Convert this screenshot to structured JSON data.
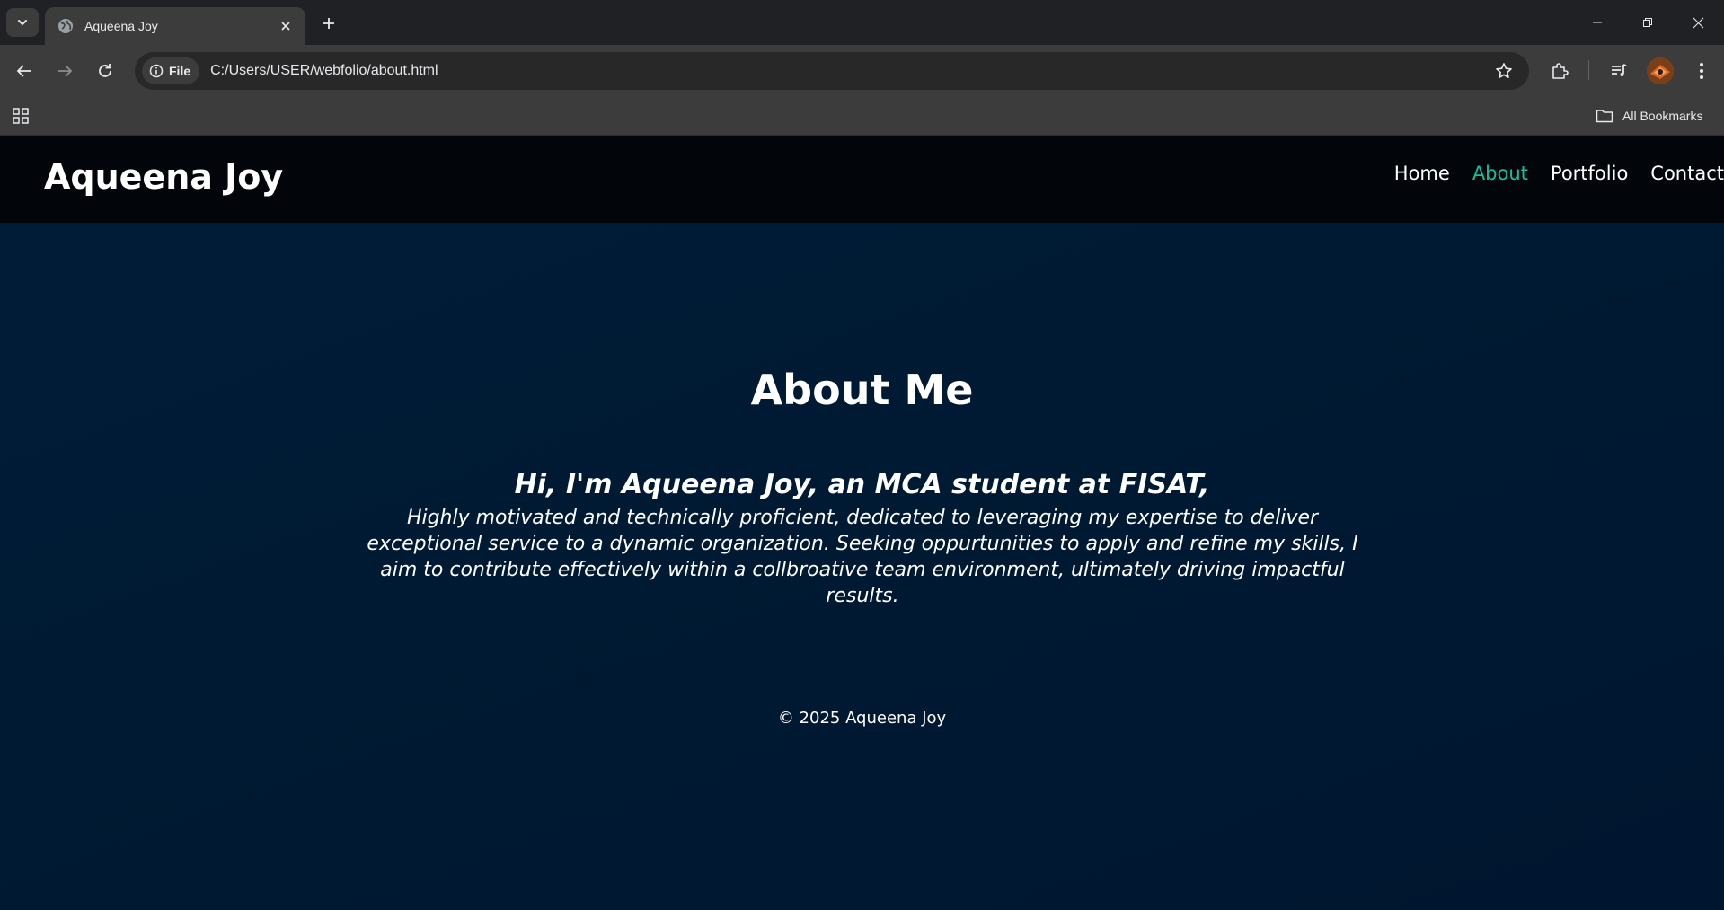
{
  "browser": {
    "tab": {
      "title": "Aqueena Joy"
    },
    "omnibox": {
      "site_chip": "File",
      "url": "C:/Users/USER/webfolio/about.html"
    },
    "bookmarks_bar": {
      "all_bookmarks": "All Bookmarks"
    }
  },
  "page": {
    "logo": "Aqueena Joy",
    "nav": [
      {
        "label": "Home",
        "active": false
      },
      {
        "label": "About",
        "active": true
      },
      {
        "label": "Portfolio",
        "active": false
      },
      {
        "label": "Contact",
        "active": false
      }
    ],
    "title": "About Me",
    "greeting": "Hi, I'm Aqueena Joy, an MCA student at FISAT,",
    "body": "Highly motivated and technically proficient, dedicated to leveraging my expertise to deliver exceptional service to a dynamic organization. Seeking oppurtunities to apply and refine my skills, I aim to contribute effectively within a collbroative team environment, ultimately driving impactful results.",
    "footer": "© 2025 Aqueena Joy"
  },
  "colors": {
    "nav_active": "#1abc9c",
    "header_bg": "#02060b",
    "page_bg": "#001a33"
  }
}
